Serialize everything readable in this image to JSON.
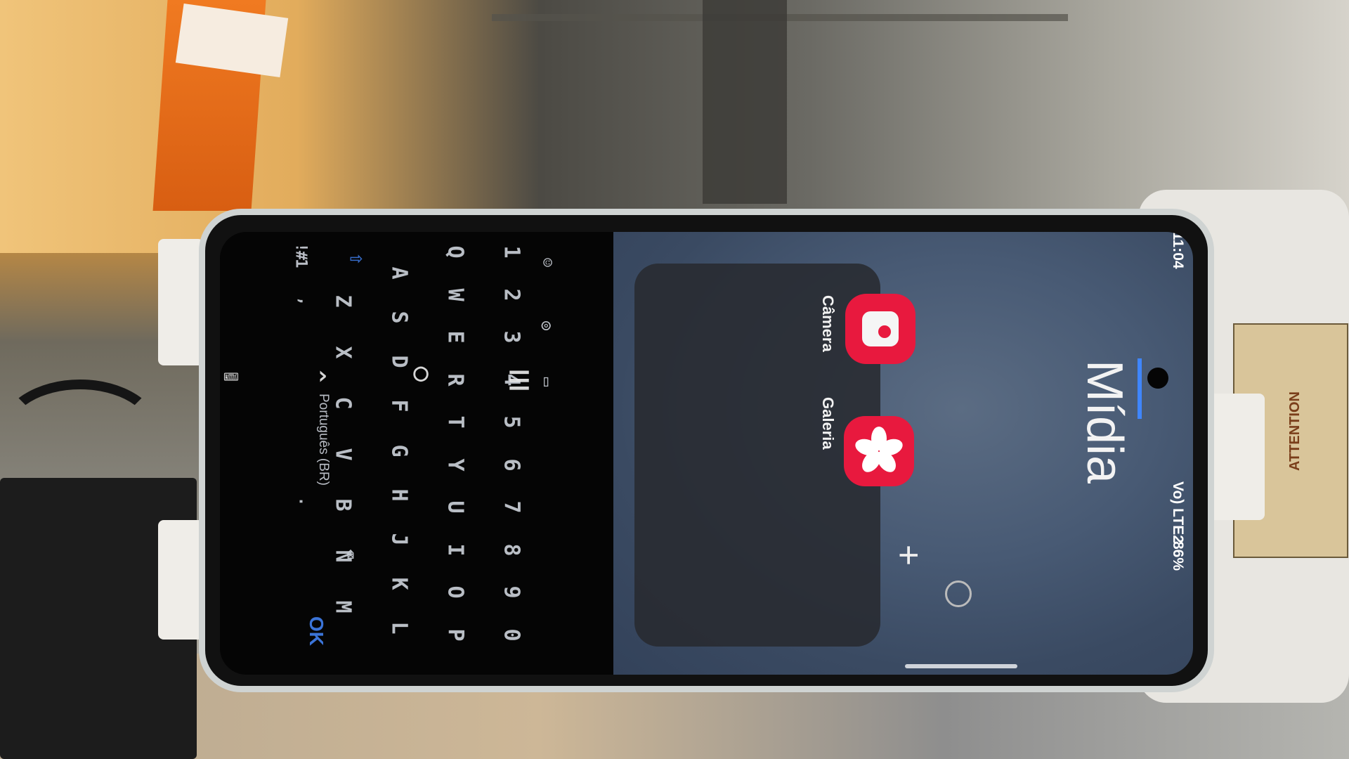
{
  "screen": {
    "folder_title": "Mídia",
    "status_time": "11:04",
    "status_battery": "86%",
    "status_network": "Vo) LTE2"
  },
  "apps": [
    {
      "label": "Câmera",
      "icon": "camera-icon"
    },
    {
      "label": "Galeria",
      "icon": "gallery-flower-icon"
    }
  ],
  "folder_controls": {
    "add_label": "+"
  },
  "keyboard": {
    "number_row": [
      "1",
      "2",
      "3",
      "4",
      "5",
      "6",
      "7",
      "8",
      "9",
      "0"
    ],
    "row1": [
      "Q",
      "W",
      "E",
      "R",
      "T",
      "Y",
      "U",
      "I",
      "O",
      "P"
    ],
    "row2": [
      "A",
      "S",
      "D",
      "F",
      "G",
      "H",
      "J",
      "K",
      "L"
    ],
    "row3": [
      "Z",
      "X",
      "C",
      "V",
      "B",
      "N",
      "M"
    ],
    "language": "Português (BR)",
    "ok_label": "OK",
    "symbols_label": "!#1",
    "comma": ",",
    "period": "."
  },
  "background": {
    "warning_label": "ATTENTION"
  }
}
